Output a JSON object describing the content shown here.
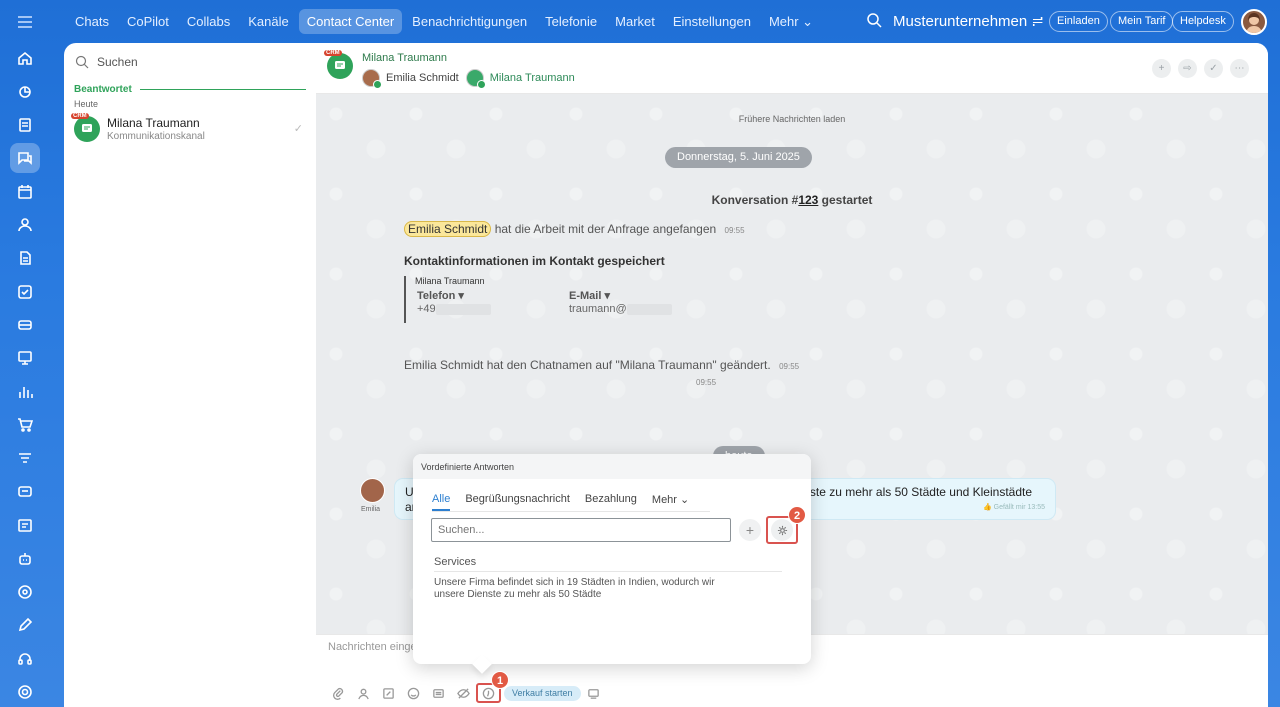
{
  "top_nav": {
    "items": [
      "Chats",
      "CoPilot",
      "Collabs",
      "Kanäle",
      "Contact Center",
      "Benachrichtigungen",
      "Telefonie",
      "Market",
      "Einstellungen",
      "Mehr ⌄"
    ],
    "active": "Contact Center",
    "company": "Musterunternehmen ≓",
    "invite_label": "Einladen",
    "plan_label": "Mein Tarif",
    "helpdesk_label": "Helpdesk"
  },
  "rail": {
    "icons": [
      "home-icon",
      "chart-icon",
      "document-icon",
      "chat-icon",
      "calendar-icon",
      "people-icon",
      "file-icon",
      "task-icon",
      "card-icon",
      "screen-icon",
      "analytics-icon",
      "cart-icon",
      "funnel-icon",
      "chat-box-icon",
      "board-icon",
      "robot-icon",
      "target-icon",
      "edit-icon",
      "headset-icon",
      "settings-icon"
    ],
    "active": "chat-icon"
  },
  "list": {
    "search_placeholder": "Suchen",
    "group_label": "Beantwortet",
    "subgroup_label": "Heute",
    "chats": [
      {
        "crm_tag": "CRM",
        "name": "Milana Traumann",
        "subtitle": "Kommunikationskanal"
      }
    ]
  },
  "chat": {
    "crm_tag": "CRM",
    "title": "Milana Traumann",
    "member_1": "Emilia Schmidt",
    "member_2": "Milana Traumann",
    "header_actions": [
      "+",
      "⇨",
      "✓",
      "⋯"
    ],
    "load_earlier": "Frühere Nachrichten laden",
    "date_label": "Donnerstag, 5. Juni 2025",
    "conversation_prefix": "Konversation #",
    "conversation_number": "123",
    "conversation_suffix": " gestartet",
    "work_mention": "Emilia Schmidt",
    "work_text": "hat die Arbeit mit der Anfrage angefangen",
    "work_time": "09:55",
    "contact_head": "Kontaktinformationen im Kontakt gespeichert",
    "contact_name": "Milana Traumann",
    "phone_label": "Telefon ▾",
    "phone_value": "+49",
    "email_label": "E-Mail ▾",
    "email_value": "traumann@",
    "contact_time": "09:55",
    "rename_text": "Emilia Schmidt hat den Chatnamen auf \"Milana Traumann\" geändert.",
    "rename_time": "09:55",
    "today_label": "heute",
    "incoming_author": "Emilia",
    "incoming_text": "Unsere Firma befindet sich in 19 Städten in Indien, wodurch wir unsere Dienste zu mehr als 50 Städte und Kleinstädte anbieten",
    "incoming_meta": "👍 Gefällt mir   13:55",
    "input_placeholder": "Nachrichten eingeben",
    "sale_label": "Verkauf starten"
  },
  "popup": {
    "title": "Vordefinierte Antworten",
    "tabs": [
      "Alle",
      "Begrüßungsnachricht",
      "Bezahlung",
      "Mehr ⌄"
    ],
    "active_tab": "Alle",
    "search_placeholder": "Suchen...",
    "add_label": "+",
    "section_label": "Services",
    "answer_text": "Unsere Firma befindet sich in 19 Städten in Indien, wodurch wir unsere Dienste zu mehr als 50 Städte"
  },
  "annotations": {
    "step_1": "1",
    "step_2": "2"
  },
  "colors": {
    "accent_blue": "#2a7be0",
    "crm_green": "#2fa35a",
    "highlight_red": "#d9534f"
  }
}
